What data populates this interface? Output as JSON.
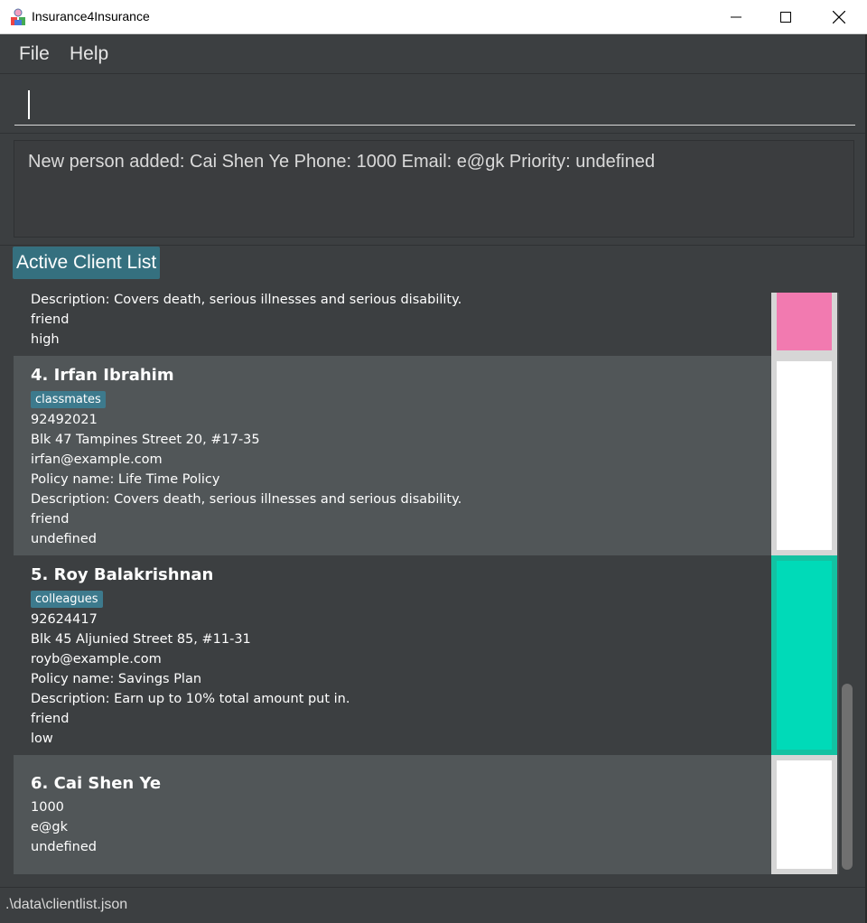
{
  "window": {
    "title": "Insurance4Insurance",
    "minimize_icon": "minimize-icon",
    "maximize_icon": "maximize-icon",
    "close_icon": "close-icon"
  },
  "menu": {
    "file": "File",
    "help": "Help"
  },
  "command": {
    "value": "",
    "placeholder": ""
  },
  "result": {
    "text": "New person added: Cai Shen Ye Phone: 1000 Email: e@gk Priority: undefined"
  },
  "list": {
    "header": "Active Client List",
    "cards": [
      {
        "name": "",
        "tag": "",
        "lines": [
          "Description: Covers death, serious illnesses and serious disability.",
          "friend",
          "high"
        ],
        "priority_color": "#f27ab0"
      },
      {
        "name": "4.  Irfan Ibrahim",
        "tag": "classmates",
        "lines": [
          "92492021",
          "Blk 47 Tampines Street 20, #17-35",
          "irfan@example.com",
          "Policy name: Life Time Policy",
          "Description: Covers death, serious illnesses and serious disability.",
          "friend",
          "undefined"
        ],
        "priority_color": "#ffffff"
      },
      {
        "name": "5.  Roy Balakrishnan",
        "tag": "colleagues",
        "lines": [
          "92624417",
          "Blk 45 Aljunied Street 85, #11-31",
          "royb@example.com",
          "Policy name: Savings Plan",
          "Description: Earn up to 10% total amount put in.",
          "friend",
          "low"
        ],
        "priority_color": "#00dab8"
      },
      {
        "name": "6.  Cai Shen Ye",
        "tag": "",
        "lines": [
          "1000",
          "e@gk",
          "undefined"
        ],
        "priority_color": "#ffffff"
      }
    ]
  },
  "status": {
    "path": ".\\data\\clientlist.json"
  },
  "colors": {
    "accent": "#35707f",
    "tag": "#3d7a8d",
    "card_dark": "#3c3f41",
    "card_light": "#515658"
  }
}
